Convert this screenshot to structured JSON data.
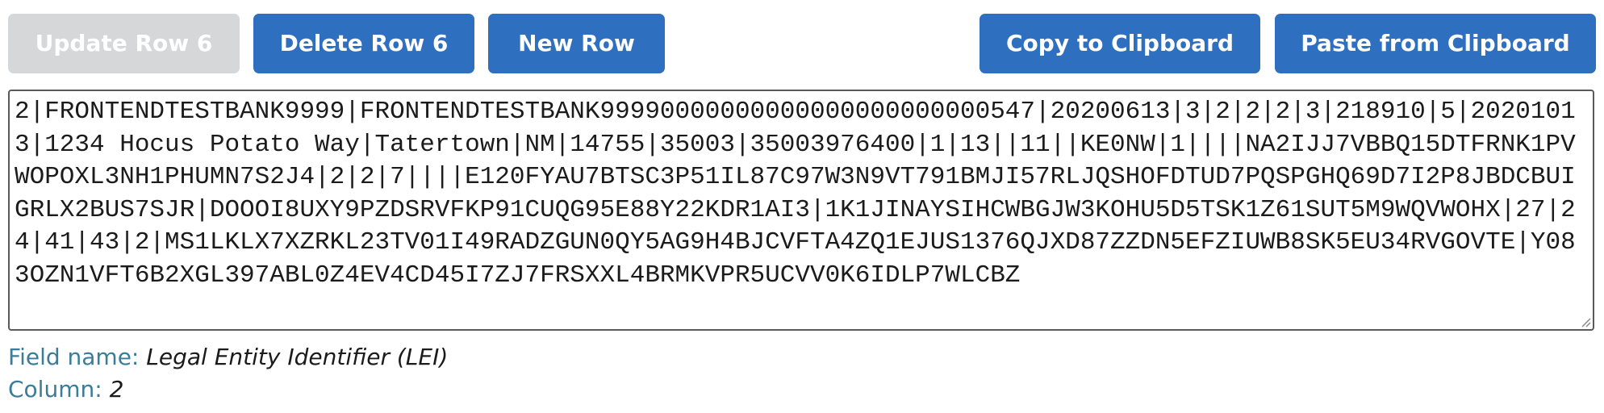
{
  "toolbar": {
    "update_label": "Update Row 6",
    "delete_label": "Delete Row 6",
    "new_label": "New Row",
    "copy_label": "Copy to Clipboard",
    "paste_label": "Paste from Clipboard"
  },
  "editor": {
    "content": "2|FRONTENDTESTBANK9999|FRONTENDTESTBANK99990000000000000000000000547|20200613|3|2|2|2|3|218910|5|20201013|1234 Hocus Potato Way|Tatertown|NM|14755|35003|35003976400|1|13||11||KE0NW|1||||NA2IJJ7VBBQ15DTFRNK1PVWOPOXL3NH1PHUMN7S2J4|2|2|7||||E120FYAU7BTSC3P51IL87C97W3N9VT791BMJI57RLJQSHOFDTUD7PQSPGHQ69D7I2P8JBDCBUIGRLX2BUS7SJR|DOOOI8UXY9PZDSRVFKP91CUQG95E88Y22KDR1AI3|1K1JINAYSIHCWBGJW3KOHU5D5TSK1Z61SUT5M9WQVWOHX|27|24|41|43|2|MS1LKLX7XZRKL23TV01I49RADZGUN0QY5AG9H4BJCVFTA4ZQ1EJUS1376QJXD87ZZDN5EFZIUWB8SK5EU34RVGOVTE|Y083OZN1VFT6B2XGL397ABL0Z4EV4CD45I7ZJ7FRSXXL4BRMKVPR5UCVV0K6IDLP7WLCBZ"
  },
  "field": {
    "name_label": "Field name:",
    "name_value": "Legal Entity Identifier (LEI)",
    "column_label": "Column:",
    "column_value": "2"
  },
  "colors": {
    "primary_button": "#2f6fbf",
    "disabled_button": "#d6d7d9",
    "label_text": "#3a7d99"
  }
}
